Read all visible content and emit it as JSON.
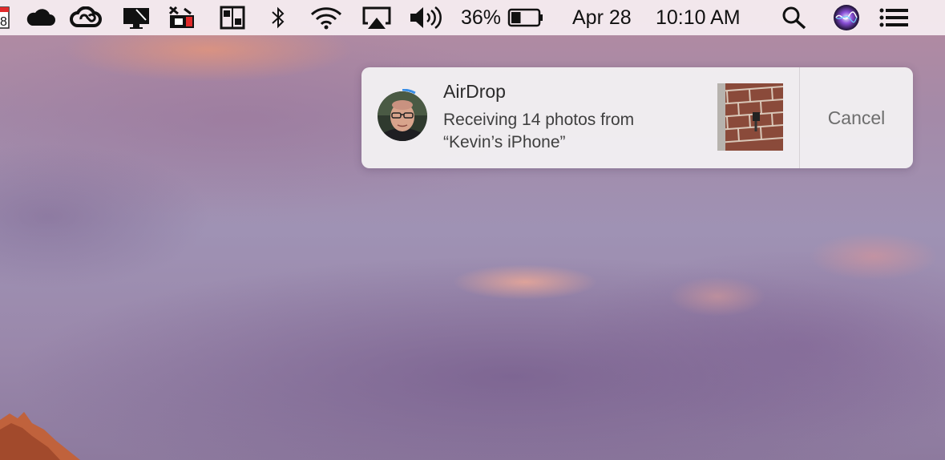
{
  "menubar": {
    "calendar_day": "8",
    "battery_percent": "36%",
    "battery_level": 0.36,
    "date": "Apr 28",
    "time": "10:10 AM",
    "icons": [
      "calendar-icon",
      "cloud-icon",
      "creative-cloud-icon",
      "display-icon",
      "cast-tools-icon",
      "switcher-icon",
      "bluetooth-icon",
      "wifi-icon",
      "airplay-icon",
      "volume-icon",
      "battery-icon",
      "search-icon",
      "siri-icon",
      "notification-center-icon"
    ]
  },
  "notification": {
    "title": "AirDrop",
    "body_line1": "Receiving 14 photos from",
    "body_line2": "“Kevin’s iPhone”",
    "cancel_label": "Cancel",
    "progress": 0.08,
    "accent": "#3a8ee6"
  },
  "colors": {
    "menubar_bg": "#f6eef2",
    "notification_bg": "#f2eff2",
    "progress_blue": "#3a8ee6"
  }
}
